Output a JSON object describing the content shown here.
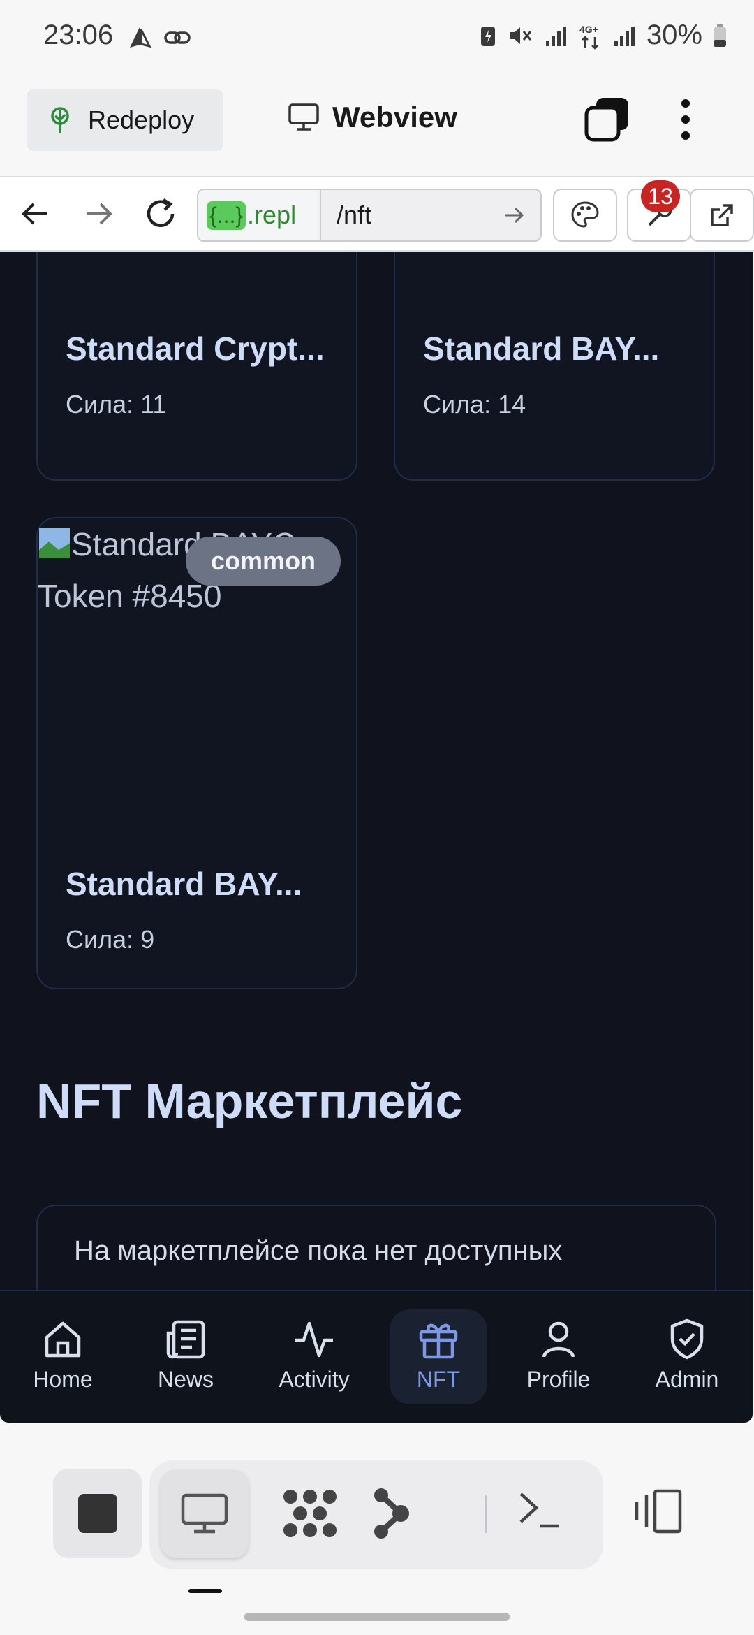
{
  "status_bar": {
    "time": "23:06",
    "battery": "30%",
    "network": "4G+"
  },
  "toolbar": {
    "redeploy_label": "Redeploy",
    "webview_title": "Webview"
  },
  "url_bar": {
    "host_badge": "{...}",
    "host_suffix": ".repl",
    "path": "/nft",
    "notification_count": "13"
  },
  "nft_cards": [
    {
      "name": "Standard Crypt...",
      "power": "Сила: 11"
    },
    {
      "name": "Standard BAY...",
      "power": "Сила: 14"
    },
    {
      "name": "Standard BAY...",
      "power": "Сила: 9",
      "alt_text": "Standard BAYC Token #8450",
      "rarity": "common"
    }
  ],
  "marketplace": {
    "title": "NFT Маркетплейс",
    "empty_text": "На маркетплейсе пока нет доступных"
  },
  "bottom_nav": [
    {
      "label": "Home",
      "icon": "home-icon"
    },
    {
      "label": "News",
      "icon": "news-icon"
    },
    {
      "label": "Activity",
      "icon": "activity-icon"
    },
    {
      "label": "NFT",
      "icon": "gift-icon",
      "active": true
    },
    {
      "label": "Profile",
      "icon": "user-icon"
    },
    {
      "label": "Admin",
      "icon": "shield-check-icon"
    }
  ],
  "colors": {
    "background": "#10131d",
    "accent": "#7d97e6",
    "heading": "#cfdcf7",
    "card_border": "#1f2c4a",
    "notification": "#c72424"
  }
}
